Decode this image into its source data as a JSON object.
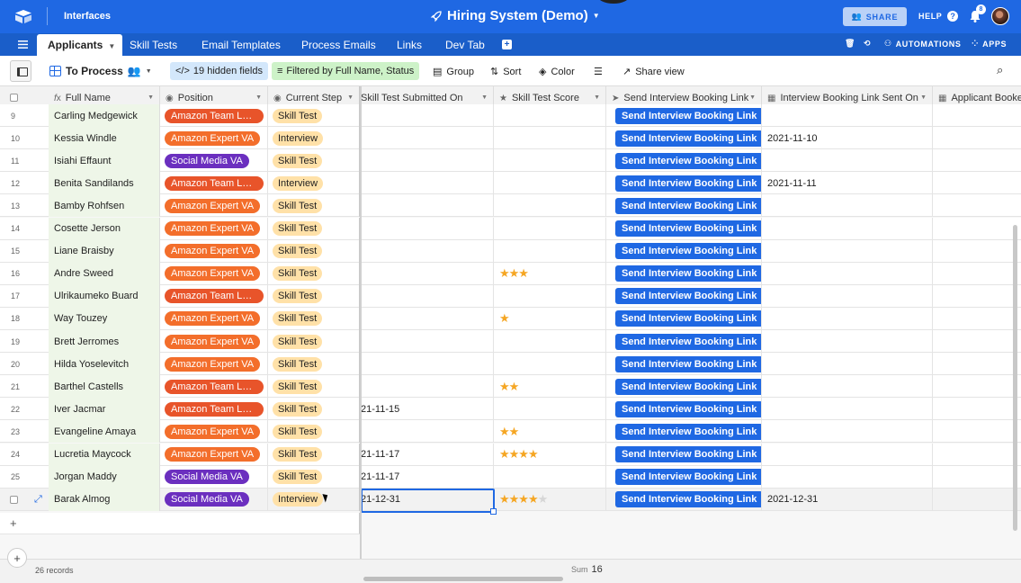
{
  "topbar": {
    "interfaces_label": "Interfaces",
    "base_title": "Hiring System (Demo)",
    "share_label": "SHARE",
    "help_label": "HELP",
    "notification_count": "8"
  },
  "tabs": [
    {
      "label": "Applicants",
      "active": true
    },
    {
      "label": "Skill Tests"
    },
    {
      "label": "Email Templates"
    },
    {
      "label": "Process Emails"
    },
    {
      "label": "Links"
    },
    {
      "label": "Dev Tab"
    }
  ],
  "tab_actions": {
    "automations_label": "AUTOMATIONS",
    "apps_label": "APPS"
  },
  "toolbar": {
    "view_name": "To Process",
    "hidden_fields": "19 hidden fields",
    "filter": "Filtered by Full Name, Status",
    "group": "Group",
    "sort": "Sort",
    "color": "Color",
    "share_view": "Share view"
  },
  "columns": {
    "full_name": "Full Name",
    "position": "Position",
    "current_step": "Current Step",
    "submitted": "Skill Test Submitted On",
    "score": "Skill Test Score",
    "send_link": "Send Interview Booking Link",
    "link_sent": "Interview Booking Link Sent On",
    "booked": "Applicant Booke"
  },
  "button_label": "Send Interview Booking Link",
  "max_score": 5,
  "rows": [
    {
      "num": "9",
      "name": "Carling Medgewick",
      "position": "Amazon Team Lea...",
      "ptype": "team",
      "step": "Skill Test",
      "submitted": "",
      "score": 0,
      "sent": ""
    },
    {
      "num": "10",
      "name": "Kessia Windle",
      "position": "Amazon Expert VA",
      "ptype": "expert",
      "step": "Interview",
      "submitted": "",
      "score": 0,
      "sent": "2021-11-10"
    },
    {
      "num": "11",
      "name": "Isiahi Effaunt",
      "position": "Social Media VA",
      "ptype": "social",
      "step": "Skill Test",
      "submitted": "",
      "score": 0,
      "sent": ""
    },
    {
      "num": "12",
      "name": "Benita Sandilands",
      "position": "Amazon Team Lea...",
      "ptype": "team",
      "step": "Interview",
      "submitted": "",
      "score": 0,
      "sent": "2021-11-11"
    },
    {
      "num": "13",
      "name": "Bamby Rohfsen",
      "position": "Amazon Expert VA",
      "ptype": "expert",
      "step": "Skill Test",
      "submitted": "",
      "score": 0,
      "sent": ""
    },
    {
      "num": "14",
      "name": "Cosette Jerson",
      "position": "Amazon Expert VA",
      "ptype": "expert",
      "step": "Skill Test",
      "submitted": "",
      "score": 0,
      "sent": ""
    },
    {
      "num": "15",
      "name": "Liane Braisby",
      "position": "Amazon Expert VA",
      "ptype": "expert",
      "step": "Skill Test",
      "submitted": "",
      "score": 0,
      "sent": ""
    },
    {
      "num": "16",
      "name": "Andre Sweed",
      "position": "Amazon Expert VA",
      "ptype": "expert",
      "step": "Skill Test",
      "submitted": "",
      "score": 3,
      "sent": ""
    },
    {
      "num": "17",
      "name": "Ulrikaumeko Buard",
      "position": "Amazon Team Lea...",
      "ptype": "team",
      "step": "Skill Test",
      "submitted": "",
      "score": 0,
      "sent": ""
    },
    {
      "num": "18",
      "name": "Way Touzey",
      "position": "Amazon Expert VA",
      "ptype": "expert",
      "step": "Skill Test",
      "submitted": "",
      "score": 1,
      "sent": ""
    },
    {
      "num": "19",
      "name": "Brett Jerromes",
      "position": "Amazon Expert VA",
      "ptype": "expert",
      "step": "Skill Test",
      "submitted": "",
      "score": 0,
      "sent": ""
    },
    {
      "num": "20",
      "name": "Hilda Yoselevitch",
      "position": "Amazon Expert VA",
      "ptype": "expert",
      "step": "Skill Test",
      "submitted": "",
      "score": 0,
      "sent": ""
    },
    {
      "num": "21",
      "name": "Barthel Castells",
      "position": "Amazon Team Lea...",
      "ptype": "team",
      "step": "Skill Test",
      "submitted": "",
      "score": 2,
      "sent": ""
    },
    {
      "num": "22",
      "name": "Iver Jacmar",
      "position": "Amazon Team Lea...",
      "ptype": "team",
      "step": "Skill Test",
      "submitted": "21-11-15",
      "score": 0,
      "sent": ""
    },
    {
      "num": "23",
      "name": "Evangeline Amaya",
      "position": "Amazon Expert VA",
      "ptype": "expert",
      "step": "Skill Test",
      "submitted": "",
      "score": 2,
      "sent": ""
    },
    {
      "num": "24",
      "name": "Lucretia Maycock",
      "position": "Amazon Expert VA",
      "ptype": "expert",
      "step": "Skill Test",
      "submitted": "21-11-17",
      "score": 4,
      "sent": ""
    },
    {
      "num": "25",
      "name": "Jorgan Maddy",
      "position": "Social Media VA",
      "ptype": "social",
      "step": "Skill Test",
      "submitted": "21-11-17",
      "score": 0,
      "sent": ""
    },
    {
      "num": "",
      "name": "Barak Almog",
      "position": "Social Media VA",
      "ptype": "social",
      "step": "Interview",
      "submitted": "21-12-31",
      "score": 4,
      "sent": "2021-12-31",
      "show_empty_stars": true
    }
  ],
  "footer": {
    "records": "26 records",
    "sum_label": "Sum",
    "sum_value": "16"
  },
  "colors": {
    "brand": "#1f68e3",
    "team_tag": "#e8542a",
    "expert_tag": "#f36e2b",
    "social_tag": "#6b2fbf",
    "step_tag": "#ffe1a8",
    "star": "#f5a623"
  }
}
